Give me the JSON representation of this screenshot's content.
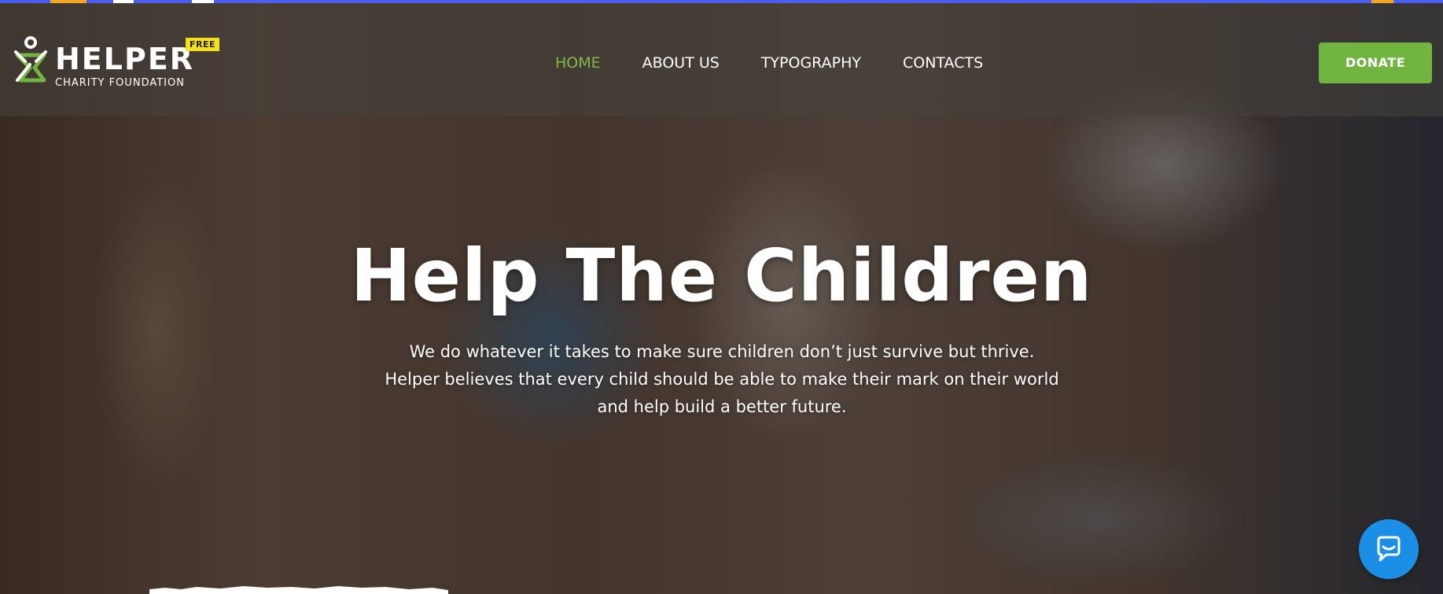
{
  "brand": {
    "name": "HELPER",
    "tagline": "CHARITY FOUNDATION",
    "badge": "FREE",
    "logo_icon": "person-heart-logo-icon",
    "colors": {
      "accent_green": "#71b440",
      "nav_active": "#7db949",
      "badge_yellow": "#f4e11b",
      "top_bar_blue": "#4a5ff0",
      "chat_blue": "#1b8fe6"
    }
  },
  "nav": {
    "items": [
      {
        "label": "HOME",
        "active": true
      },
      {
        "label": "ABOUT US",
        "active": false
      },
      {
        "label": "TYPOGRAPHY",
        "active": false
      },
      {
        "label": "CONTACTS",
        "active": false
      }
    ]
  },
  "header": {
    "donate_label": "DONATE"
  },
  "hero": {
    "title": "Help The Children",
    "text": "We do whatever it takes to make sure children don’t just survive but thrive. Helper believes that every child should be able to make their mark on their world and help build a better future."
  },
  "chat": {
    "icon": "chat-bubble-icon"
  }
}
